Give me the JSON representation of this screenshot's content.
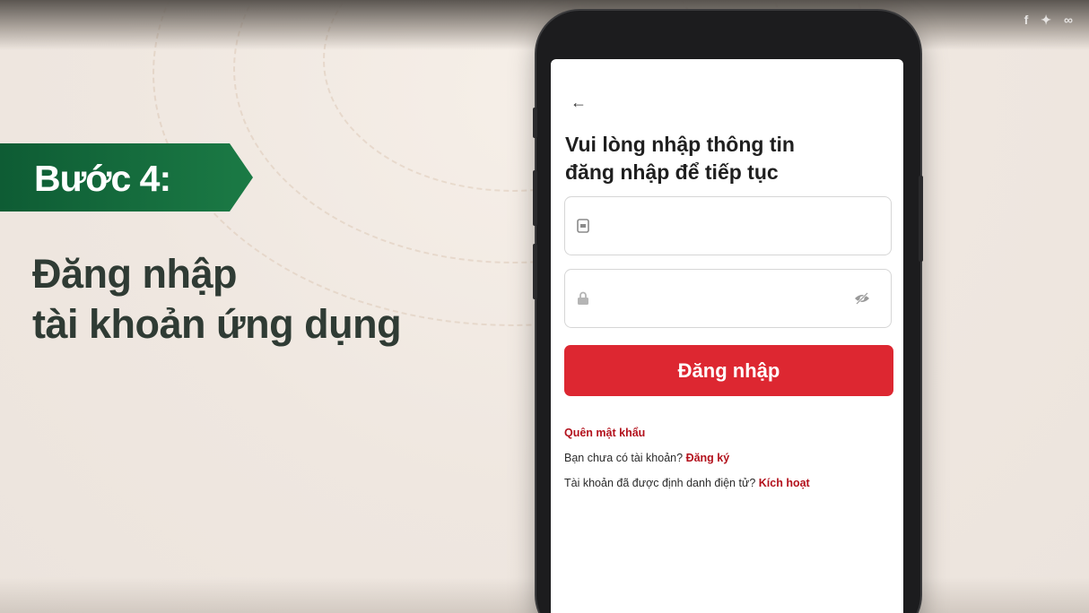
{
  "video": {
    "step_label": "Bước 4:",
    "headline_line1": "Đăng nhập",
    "headline_line2": "tài khoản ứng dụng",
    "share_icons": [
      "facebook-icon",
      "twitter-icon",
      "link-icon"
    ],
    "colors": {
      "badge_green": "#1b7a45",
      "headline": "#2f3b34"
    }
  },
  "app": {
    "title_line1": "Vui lòng nhập thông tin",
    "title_line2": "đăng nhập để tiếp tục",
    "username": {
      "value": "",
      "placeholder": "",
      "icon": "id-card-icon"
    },
    "password": {
      "value": "",
      "placeholder": "",
      "icon": "lock-icon",
      "toggle_icon": "eye-slash-icon"
    },
    "login_label": "Đăng nhập",
    "forgot_password": "Quên mật khẩu",
    "no_account_text": "Bạn chưa có tài khoản?",
    "register_link": "Đăng ký",
    "identified_text": "Tài khoản đã được định danh điện tử?",
    "activate_link": "Kích hoạt",
    "colors": {
      "primary_red": "#dd2731",
      "link_red": "#b3121d"
    }
  }
}
